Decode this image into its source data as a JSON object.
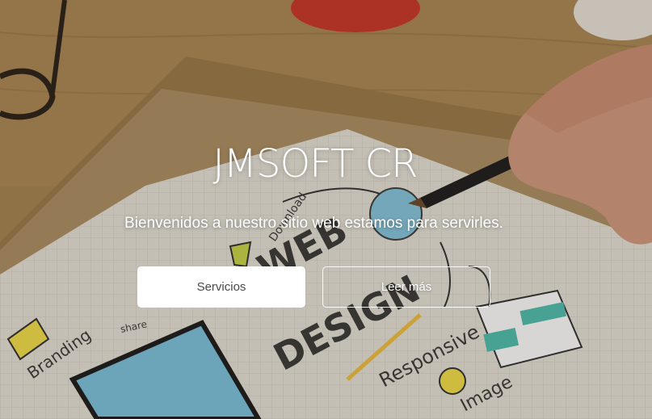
{
  "hero": {
    "title": "JMSOFT CR",
    "subtitle": "Bienvenidos a nuestro sitio web estamos para servirles.",
    "buttons": {
      "primary_label": "Servicios",
      "secondary_label": "Leer más"
    },
    "background_image": {
      "description_icon": "web-design-sketch-photo",
      "doodles": [
        "Download",
        "WEB",
        "DESIGN",
        "Responsive",
        "Image",
        "Branding",
        "share"
      ]
    }
  },
  "colors": {
    "button_primary_bg": "#ffffff",
    "button_primary_text": "#4a4a4a",
    "text_on_hero": "#ffffff",
    "doodle_blue": "#7cc3e0",
    "doodle_yellow": "#f2e04a",
    "doodle_teal": "#4fc0b0"
  }
}
